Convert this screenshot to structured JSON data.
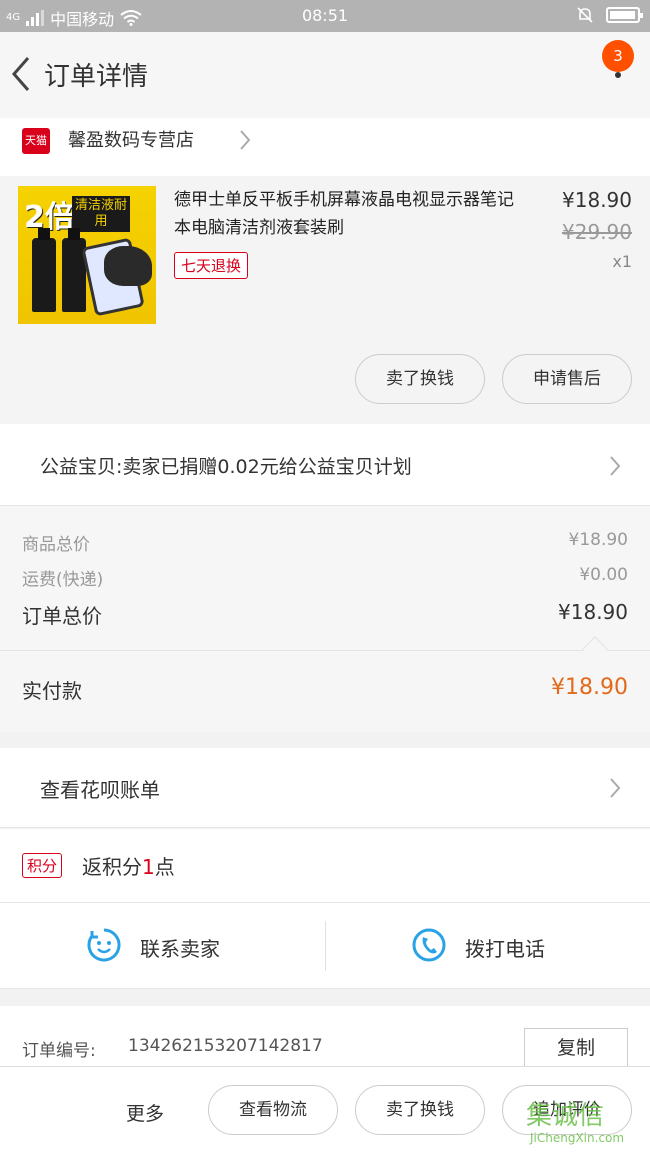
{
  "status_bar": {
    "signal": "4G",
    "carrier": "中国移动",
    "time": "08:51",
    "icons": [
      "signal-icon",
      "wifi-icon",
      "bell-off-icon",
      "battery-icon"
    ],
    "battery_level": 0.95
  },
  "nav": {
    "title": "订单详情",
    "badge_count": "3"
  },
  "store": {
    "brand_badge": "天猫",
    "name": "馨盈数码专营店"
  },
  "product": {
    "image_text_big": "2倍",
    "image_text_tag": "清洁液耐用",
    "title": "德甲士单反平板手机屏幕液晶电视显示器笔记本电脑清洁剂液套装刷",
    "return_policy": "七天退换",
    "price": "¥18.90",
    "original_price": "¥29.90",
    "quantity": "x1",
    "actions": [
      "卖了换钱",
      "申请售后"
    ]
  },
  "charity": {
    "text": "公益宝贝:卖家已捐赠0.02元给公益宝贝计划"
  },
  "totals": {
    "rows": [
      {
        "label": "商品总价",
        "value": "¥18.90"
      },
      {
        "label": "运费(快递)",
        "value": "¥0.00"
      },
      {
        "label": "订单总价",
        "value": "¥18.90"
      }
    ],
    "paid_label": "实付款",
    "paid_value": "¥18.90"
  },
  "huabei": {
    "text": "查看花呗账单"
  },
  "points": {
    "tag": "积分",
    "text_prefix": "返积分",
    "value": "1",
    "text_suffix": "点"
  },
  "contact": {
    "seller_label": "联系卖家",
    "phone_label": "拨打电话"
  },
  "order": {
    "number_label": "订单编号:",
    "number": "134262153207142817",
    "copy_label": "复制"
  },
  "bottom_bar": {
    "more_label": "更多",
    "buttons": [
      "查看物流",
      "卖了换钱",
      "追加评价"
    ]
  },
  "watermark": {
    "text": "集诚信",
    "sub": "JiChengXin.com"
  },
  "colors": {
    "accent_orange": "#ff5000",
    "tmall_red": "#d9001b",
    "paid_orange": "#e26a1a",
    "contact_blue": "#2aa3e6"
  }
}
